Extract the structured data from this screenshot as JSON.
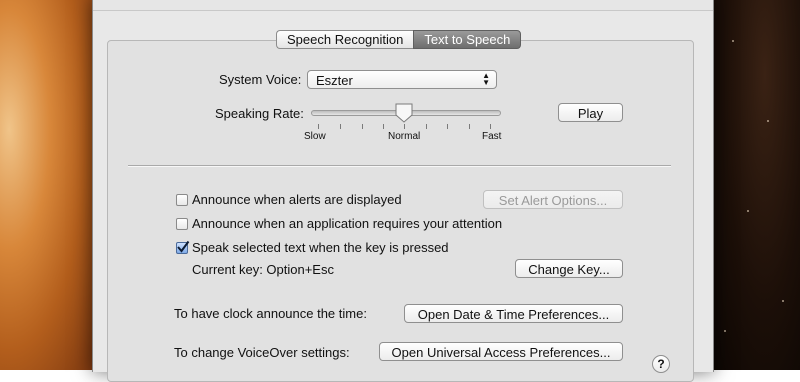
{
  "tabs": [
    {
      "label": "Speech Recognition",
      "active": false
    },
    {
      "label": "Text to Speech",
      "active": true
    }
  ],
  "system_voice": {
    "label": "System Voice:",
    "value": "Eszter"
  },
  "speaking_rate": {
    "label": "Speaking Rate:",
    "slow": "Slow",
    "normal": "Normal",
    "fast": "Fast",
    "level_fraction": 0.47
  },
  "play_button": "Play",
  "options": [
    {
      "label": "Announce when alerts are displayed",
      "checked": false
    },
    {
      "label": "Announce when an application requires your attention",
      "checked": false
    },
    {
      "label": "Speak selected text when the key is pressed",
      "checked": true
    }
  ],
  "set_alert_options_button": "Set Alert Options...",
  "current_key": "Current key: Option+Esc",
  "change_key_button": "Change Key...",
  "clock": {
    "label": "To have clock announce the time:",
    "button": "Open Date & Time Preferences..."
  },
  "voiceover": {
    "label": "To change VoiceOver settings:",
    "button": "Open Universal Access Preferences..."
  },
  "help_button": "?",
  "colors": {
    "checkbox_checked": "#7ea9e6",
    "active_tab": "#6e6e6e"
  }
}
